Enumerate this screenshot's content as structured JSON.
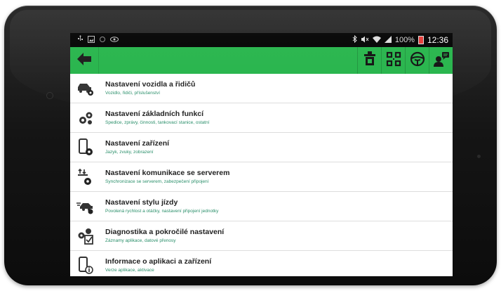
{
  "statusbar": {
    "left_icons": [
      "usb-icon",
      "image-icon",
      "sync-icon",
      "eye-icon"
    ],
    "right_icons": [
      "bluetooth-icon",
      "mute-icon",
      "wifi-icon",
      "signal-icon"
    ],
    "battery": "100%",
    "time": "12:36"
  },
  "toolbar": {
    "back_icon": "arrow-left-icon",
    "icons": [
      "vehicle-icon",
      "qr-code-icon",
      "steering-wheel-icon",
      "driver-message-icon"
    ],
    "color": "#25b44a"
  },
  "menu": {
    "items": [
      {
        "title": "Nastavení vozidla a řidičů",
        "subtitle": "Vozidlo, řidiči, příslušenství",
        "icon": "car-gear-icon"
      },
      {
        "title": "Nastavení základních funkcí",
        "subtitle": "Spedice, zprávy, činnosti, tankovací stanice, ostatní",
        "icon": "gears-icon"
      },
      {
        "title": "Nastavení zařízení",
        "subtitle": "Jazyk, zvuky, zobrazení",
        "icon": "phone-gear-icon"
      },
      {
        "title": "Nastavení komunikace se serverem",
        "subtitle": "Synchronizace se serverem, zabezpečení připojení",
        "icon": "sync-gear-icon"
      },
      {
        "title": "Nastavení stylu jízdy",
        "subtitle": "Povolená rychlost a otáčky, nastavení připojení jednotky",
        "icon": "speed-car-icon"
      },
      {
        "title": "Diagnostika a pokročilé nastavení",
        "subtitle": "Záznamy aplikace, datové přenosy",
        "icon": "diagnostics-icon"
      },
      {
        "title": "Informace o aplikaci a zařízení",
        "subtitle": "Verze aplikace, aktivace",
        "icon": "phone-info-icon"
      }
    ]
  },
  "colors": {
    "accent": "#25b44a",
    "subtitle": "#2a8f6a"
  }
}
